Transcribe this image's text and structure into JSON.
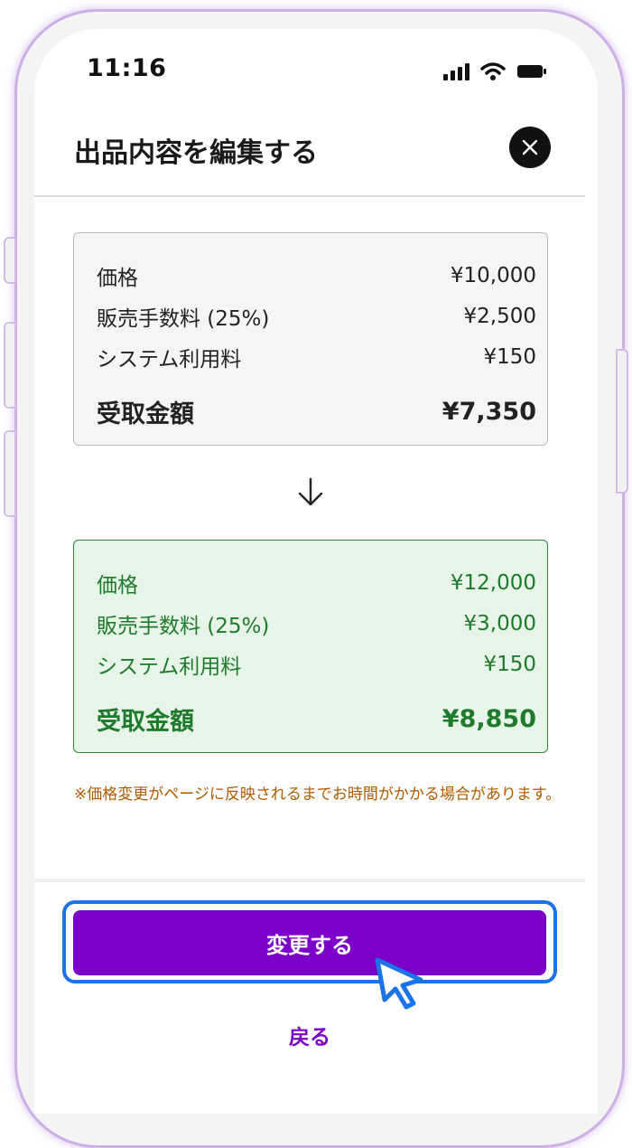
{
  "status_bar": {
    "time": "11:16"
  },
  "header": {
    "title": "出品内容を編集する"
  },
  "before": {
    "rows": [
      {
        "label": "価格",
        "value": "¥10,000"
      },
      {
        "label": "販売手数料 (25%)",
        "value": "¥2,500"
      },
      {
        "label": "システム利用料",
        "value": "¥150"
      }
    ],
    "total": {
      "label": "受取金額",
      "value": "¥7,350"
    }
  },
  "after": {
    "rows": [
      {
        "label": "価格",
        "value": "¥12,000"
      },
      {
        "label": "販売手数料 (25%)",
        "value": "¥3,000"
      },
      {
        "label": "システム利用料",
        "value": "¥150"
      }
    ],
    "total": {
      "label": "受取金額",
      "value": "¥8,850"
    }
  },
  "note": "※価格変更がページに反映されるまでお時間がかかる場合があります。",
  "actions": {
    "change_label": "変更する",
    "back_label": "戻る"
  },
  "icons": {
    "close": "close-icon",
    "arrow": "arrow-down-icon",
    "cursor": "pointer-cursor-icon"
  },
  "colors": {
    "accent": "#7b00c8",
    "success": "#1f7a2c",
    "warning": "#b05a00",
    "focus": "#1a73e8"
  }
}
